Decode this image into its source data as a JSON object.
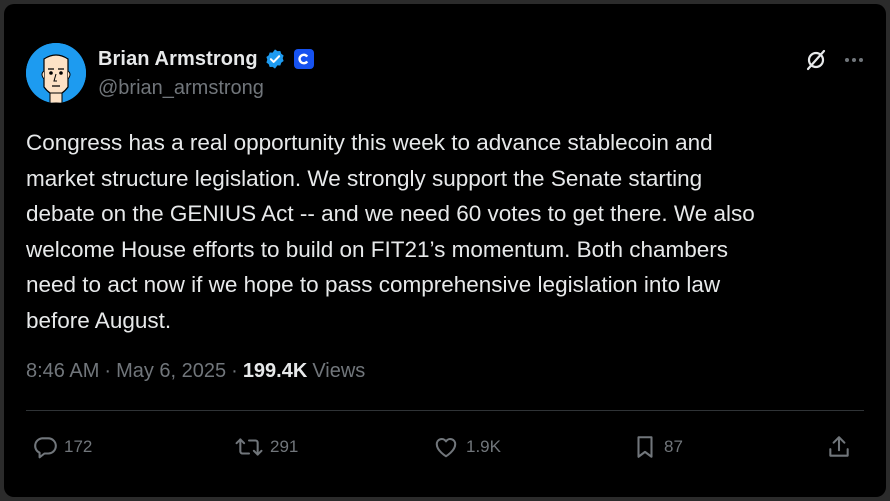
{
  "author": {
    "display_name": "Brian Armstrong",
    "handle": "@brian_armstrong",
    "avatar_icon": "cartoon-face-avatar",
    "verified_icon": "verified-badge-icon",
    "affiliate_icon": "coinbase-logo-icon"
  },
  "top_actions": {
    "grok_icon": "grok-icon",
    "more_icon": "more-options-icon"
  },
  "post": {
    "text": "Congress has a real opportunity this week to advance stablecoin and\nmarket structure legislation. We strongly support the Senate starting\ndebate on the GENIUS Act -- and we need 60 votes to get there. We also\nwelcome House efforts to build on FIT21’s momentum. Both chambers\nneed to act now if we hope to pass comprehensive legislation into law\nbefore August."
  },
  "meta": {
    "time": "8:46 AM",
    "separator": "·",
    "date": "May 6, 2025",
    "views_count": "199.4K",
    "views_label": "Views"
  },
  "engagement": {
    "replies": "172",
    "reposts": "291",
    "likes": "1.9K",
    "bookmarks": "87"
  },
  "colors": {
    "background": "#000000",
    "text": "#e7e9ea",
    "secondary": "#71767b",
    "accent": "#1d9bf0",
    "coinbase": "#1652f0"
  }
}
